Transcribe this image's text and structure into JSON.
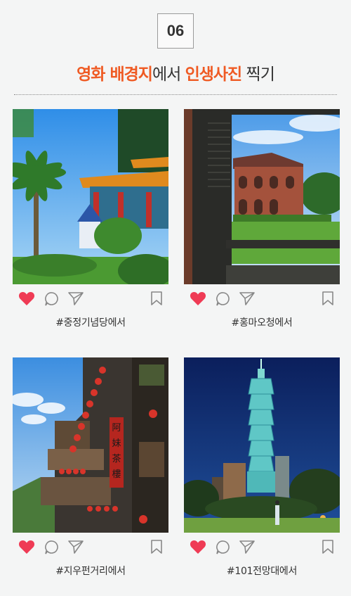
{
  "badge": "06",
  "title": {
    "part1": "영화 배경지",
    "part2": "에서 ",
    "part3": "인생사진",
    "part4": " 찍기"
  },
  "colors": {
    "accent": "#ef5a23",
    "heart": "#ef3b55"
  },
  "posts": [
    {
      "caption": "#중정기념당에서",
      "icons": [
        "heart-icon",
        "comment-icon",
        "send-icon",
        "bookmark-icon"
      ]
    },
    {
      "caption": "#홍마오청에서",
      "icons": [
        "heart-icon",
        "comment-icon",
        "send-icon",
        "bookmark-icon"
      ]
    },
    {
      "caption": "#지우펀거리에서",
      "icons": [
        "heart-icon",
        "comment-icon",
        "send-icon",
        "bookmark-icon"
      ]
    },
    {
      "caption": "#101전망대에서",
      "icons": [
        "heart-icon",
        "comment-icon",
        "send-icon",
        "bookmark-icon"
      ]
    }
  ],
  "signs": [
    "阿",
    "妹",
    "茶",
    "樓"
  ]
}
